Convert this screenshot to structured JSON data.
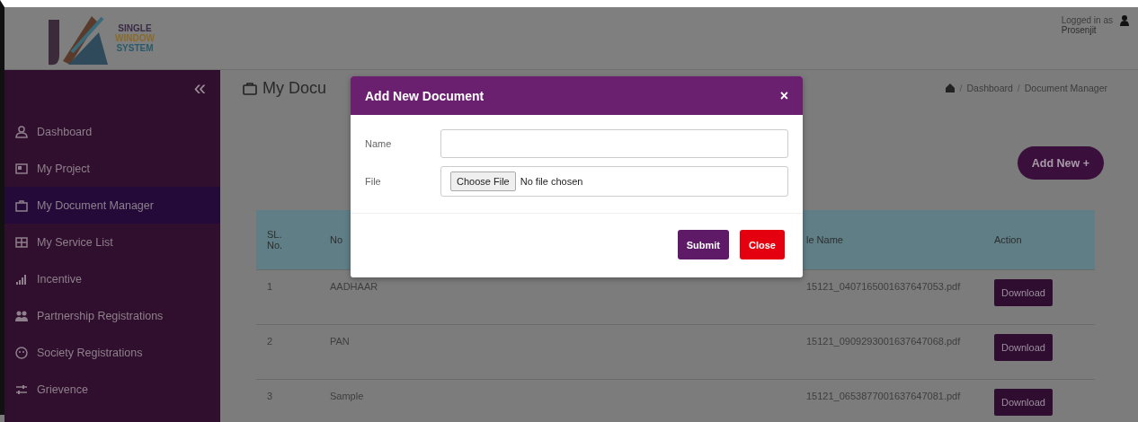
{
  "header": {
    "logo_lines": [
      "SINGLE",
      "WINDOW",
      "SYSTEM"
    ],
    "user": {
      "label": "Logged in as",
      "name": "Prosenjit"
    }
  },
  "sidebar": {
    "collapse": "«",
    "items": [
      {
        "label": "Dashboard",
        "selected": false
      },
      {
        "label": "My Project",
        "selected": false
      },
      {
        "label": "My Document Manager",
        "selected": true
      },
      {
        "label": "My Service List",
        "selected": false
      },
      {
        "label": "Incentive",
        "selected": false
      },
      {
        "label": "Partnership Registrations",
        "selected": false
      },
      {
        "label": "Society Registrations",
        "selected": false
      },
      {
        "label": "Grievence",
        "selected": false
      }
    ]
  },
  "page": {
    "title": "My Docu",
    "breadcrumb": [
      {
        "kind": "separator",
        "text": "/"
      },
      {
        "kind": "link",
        "text": "Dashboard"
      },
      {
        "kind": "separator",
        "text": "/"
      },
      {
        "kind": "link",
        "text": "Document Manager"
      }
    ],
    "add_button": "Add New +"
  },
  "table": {
    "columns": [
      "SL. No.",
      "No",
      "le Name",
      "Action"
    ],
    "rows": [
      {
        "sl": "1",
        "name": "AADHAAR",
        "file": "15121_0407165001637647053.pdf",
        "action": "Download"
      },
      {
        "sl": "2",
        "name": "PAN",
        "file": "15121_0909293001637647068.pdf",
        "action": "Download"
      },
      {
        "sl": "3",
        "name": "Sample",
        "file": "15121_0653877001637647081.pdf",
        "action": "Download"
      }
    ]
  },
  "modal": {
    "title": "Add New Document",
    "close": "×",
    "fields": [
      {
        "label": "Name",
        "kind": "text"
      },
      {
        "label": "File",
        "kind": "file",
        "button": "Choose File",
        "status": "No file chosen"
      }
    ],
    "buttons": [
      {
        "label": "Submit",
        "kind": "primary"
      },
      {
        "label": "Close",
        "kind": "danger"
      }
    ]
  }
}
